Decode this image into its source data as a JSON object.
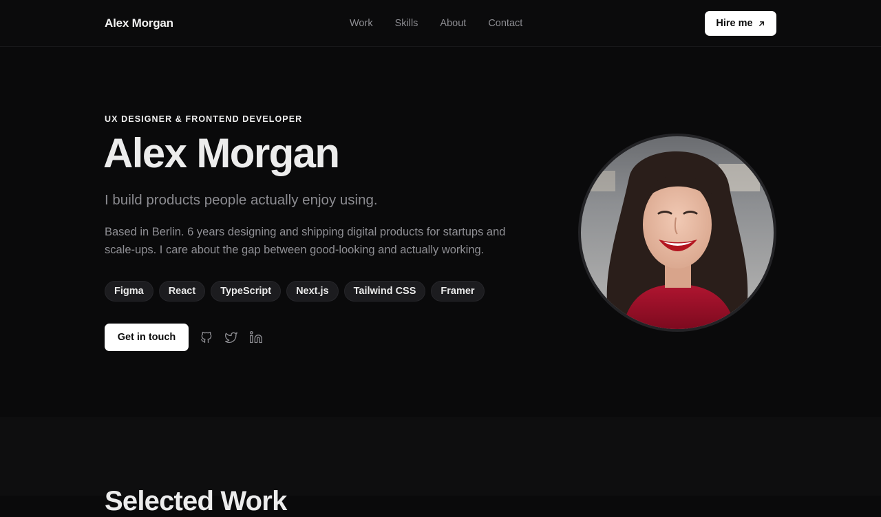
{
  "nav": {
    "brand": "Alex Morgan",
    "links": [
      "Work",
      "Skills",
      "About",
      "Contact"
    ],
    "hire_label": "Hire me"
  },
  "hero": {
    "eyebrow": "UX DESIGNER & FRONTEND DEVELOPER",
    "title": "Alex Morgan",
    "tagline": "I build products people actually enjoy using.",
    "bio": "Based in Berlin. 6 years designing and shipping digital products for startups and scale-ups. I care about the gap between good-looking and actually working.",
    "skills": [
      "Figma",
      "React",
      "TypeScript",
      "Next.js",
      "Tailwind CSS",
      "Framer"
    ],
    "cta_label": "Get in touch",
    "socials": [
      "github-icon",
      "twitter-icon",
      "linkedin-icon"
    ]
  },
  "work": {
    "title": "Selected Work"
  },
  "colors": {
    "background": "#0a0a0b",
    "accent": "#ffffff",
    "muted_text": "#8d8d92",
    "chip_bg": "#1c1c1f"
  }
}
